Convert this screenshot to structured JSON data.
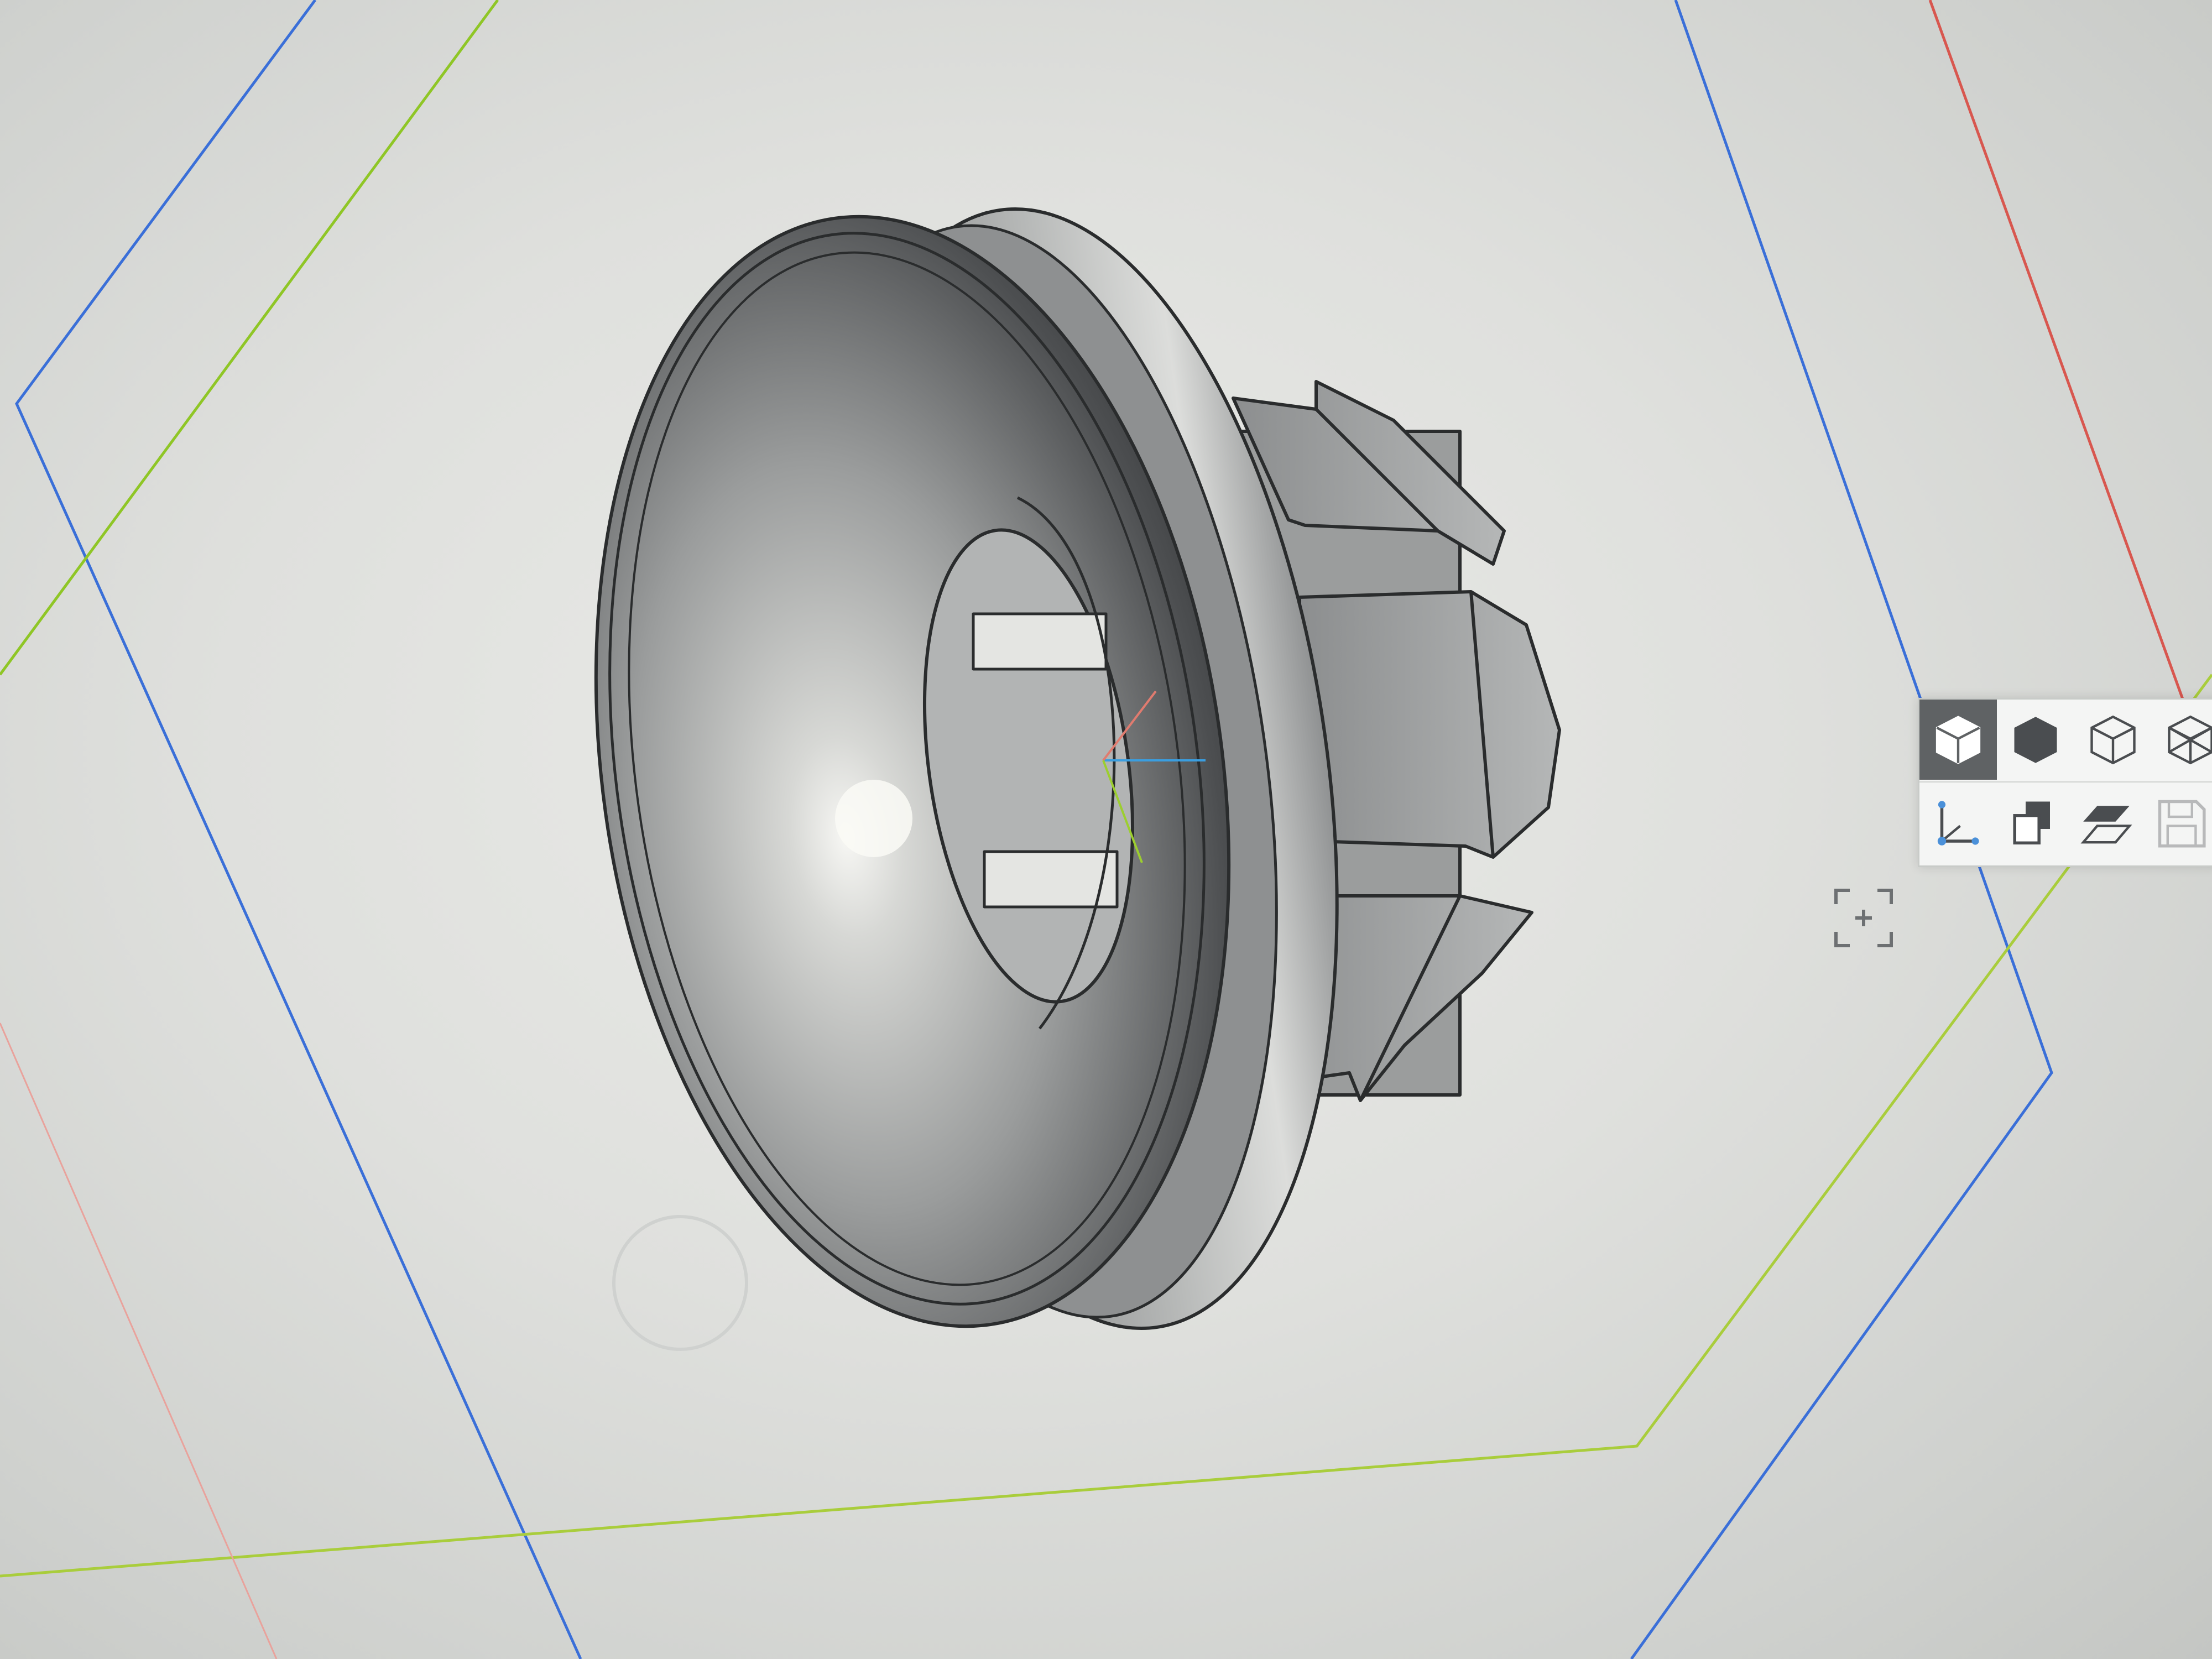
{
  "viewport": {
    "background": "#dfe0dd",
    "grid_colors": {
      "x_axis": "#3a6fd8",
      "y_axis": "#8fc626",
      "z_axis": "#d8574f"
    },
    "model": {
      "name_icon": "push-in-grommet-model",
      "body_color": "#a9abab",
      "edge_color": "#2a2c2d"
    }
  },
  "view_toolbar": {
    "row1": [
      {
        "icon": "shaded-cube-icon",
        "state": "active"
      },
      {
        "icon": "solid-cube-icon",
        "state": "normal"
      },
      {
        "icon": "wireframe-cube-icon",
        "state": "normal"
      },
      {
        "icon": "hidden-line-cube-icon",
        "state": "normal"
      }
    ],
    "row2": [
      {
        "icon": "axes-icon",
        "state": "normal"
      },
      {
        "icon": "layers-icon",
        "state": "normal"
      },
      {
        "icon": "section-plane-icon",
        "state": "normal"
      },
      {
        "icon": "save-icon",
        "state": "disabled"
      }
    ]
  },
  "zoom_fit": {
    "icon": "zoom-fit-icon"
  }
}
